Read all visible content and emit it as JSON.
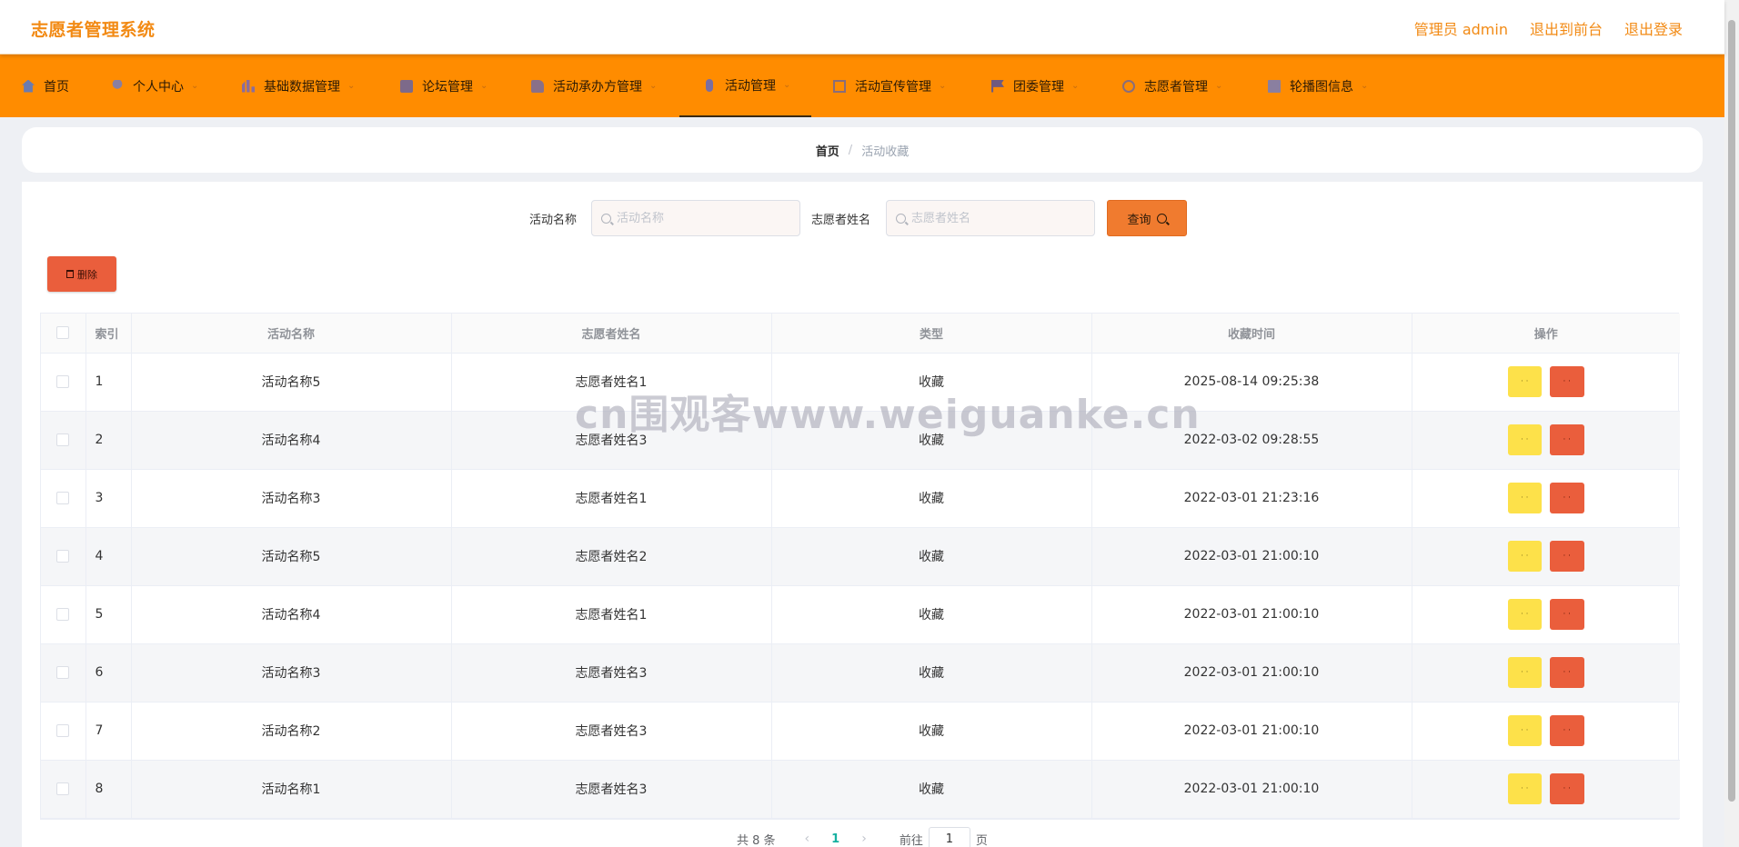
{
  "header": {
    "app_title": "志愿者管理系统",
    "user_label": "管理员 admin",
    "to_front_label": "退出到前台",
    "logout_label": "退出登录"
  },
  "nav": {
    "items": [
      {
        "label": "首页",
        "icon": "house-icon"
      },
      {
        "label": "个人中心",
        "icon": "person-icon"
      },
      {
        "label": "基础数据管理",
        "icon": "bar-chart-icon"
      },
      {
        "label": "论坛管理",
        "icon": "chat-icon"
      },
      {
        "label": "活动承办方管理",
        "icon": "thumb-icon"
      },
      {
        "label": "活动管理",
        "icon": "microphone-icon",
        "active": true
      },
      {
        "label": "活动宣传管理",
        "icon": "frame-icon"
      },
      {
        "label": "团委管理",
        "icon": "flag-icon"
      },
      {
        "label": "志愿者管理",
        "icon": "ring-icon"
      },
      {
        "label": "轮播图信息",
        "icon": "document-icon"
      }
    ]
  },
  "breadcrumb": {
    "home": "首页",
    "separator": "/",
    "current": "活动收藏"
  },
  "search": {
    "activity_label": "活动名称",
    "activity_placeholder": "活动名称",
    "activity_value": "",
    "volunteer_label": "志愿者姓名",
    "volunteer_placeholder": "志愿者姓名",
    "volunteer_value": "",
    "query_label": "查询"
  },
  "toolbar": {
    "delete_label": "删除"
  },
  "table": {
    "headers": {
      "index": "索引",
      "activity": "活动名称",
      "volunteer": "志愿者姓名",
      "type": "类型",
      "time": "收藏时间",
      "ops": "操作"
    },
    "rows": [
      {
        "index": "1",
        "activity": "活动名称5",
        "volunteer": "志愿者姓名1",
        "type": "收藏",
        "time": "2025-08-14 09:25:38"
      },
      {
        "index": "2",
        "activity": "活动名称4",
        "volunteer": "志愿者姓名3",
        "type": "收藏",
        "time": "2022-03-02 09:28:55"
      },
      {
        "index": "3",
        "activity": "活动名称3",
        "volunteer": "志愿者姓名1",
        "type": "收藏",
        "time": "2022-03-01 21:23:16"
      },
      {
        "index": "4",
        "activity": "活动名称5",
        "volunteer": "志愿者姓名2",
        "type": "收藏",
        "time": "2022-03-01 21:00:10"
      },
      {
        "index": "5",
        "activity": "活动名称4",
        "volunteer": "志愿者姓名1",
        "type": "收藏",
        "time": "2022-03-01 21:00:10"
      },
      {
        "index": "6",
        "activity": "活动名称3",
        "volunteer": "志愿者姓名3",
        "type": "收藏",
        "time": "2022-03-01 21:00:10"
      },
      {
        "index": "7",
        "activity": "活动名称2",
        "volunteer": "志愿者姓名3",
        "type": "收藏",
        "time": "2022-03-01 21:00:10"
      },
      {
        "index": "8",
        "activity": "活动名称1",
        "volunteer": "志愿者姓名3",
        "type": "收藏",
        "time": "2022-03-01 21:00:10"
      }
    ],
    "op_detail_glyph": "· ·",
    "op_delete_glyph": "· ·"
  },
  "pagination": {
    "total": "共 8 条",
    "prev_glyph": "‹",
    "current_page": "1",
    "next_glyph": "›",
    "goto_label": "前往",
    "goto_value": "1",
    "page_suffix": "页"
  },
  "watermark": "cn围观客www.weiguanke.cn",
  "colors": {
    "brand_orange": "#ff8c00",
    "title_orange": "#f28a14",
    "query_orange": "#f07b2f",
    "danger_red": "#ea5e3c",
    "detail_yellow": "#fde14a",
    "active_page": "#16b0a0"
  }
}
